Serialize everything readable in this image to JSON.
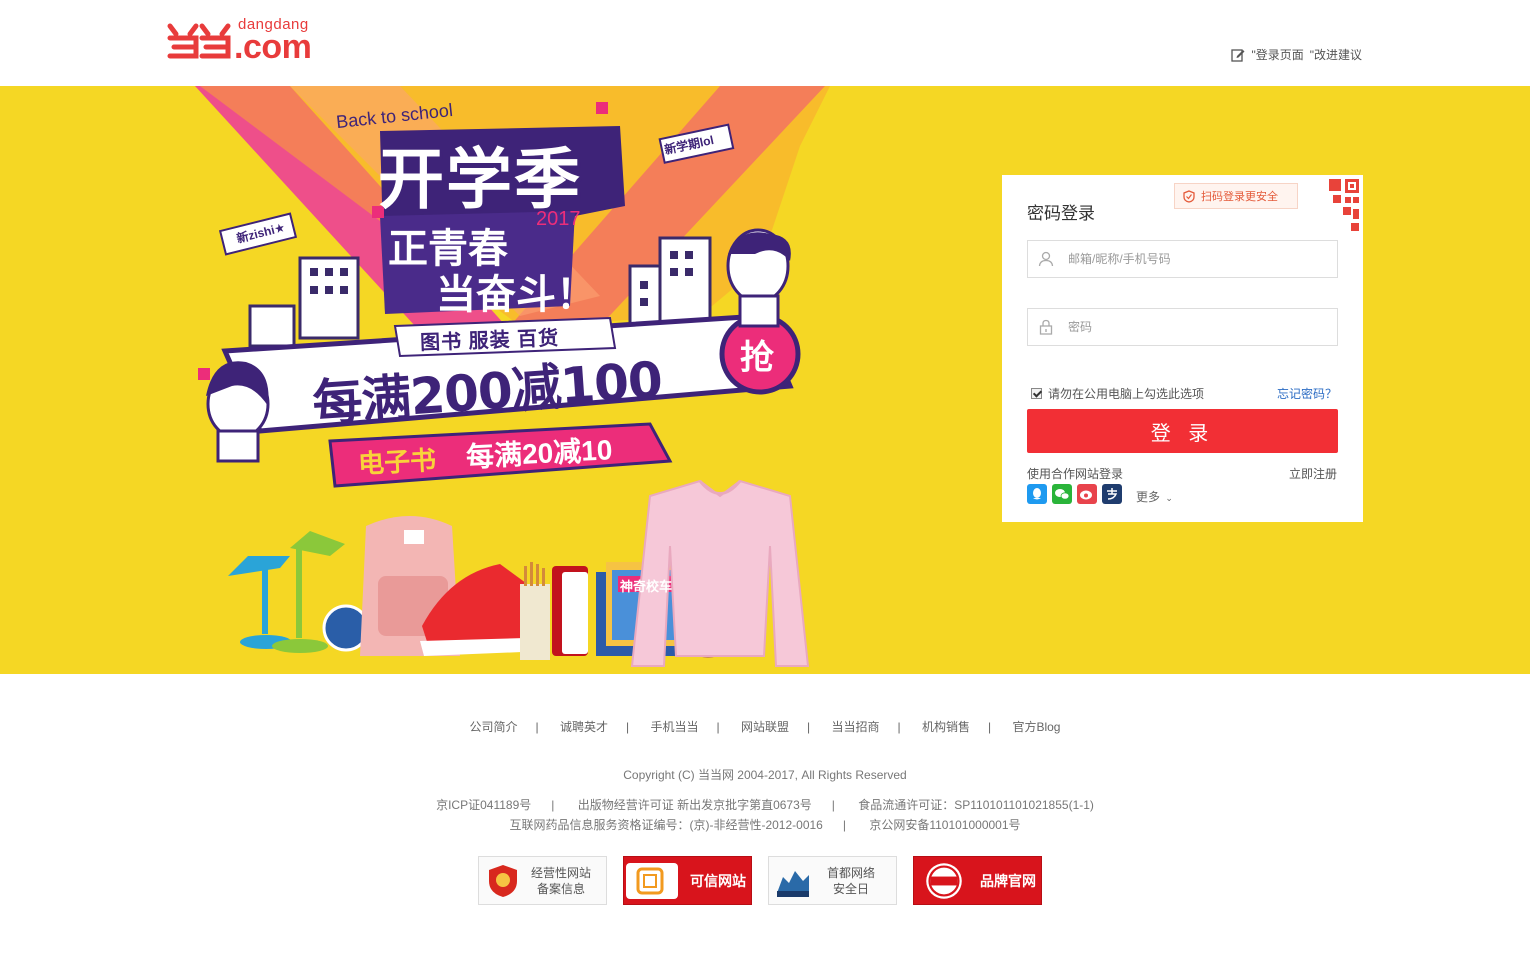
{
  "header": {
    "logo_small": "dangdang",
    "logo_big": ".com",
    "feedback_prefix": "\"登录页面",
    "feedback_suffix": "\"改进建议"
  },
  "banner": {
    "back_to_school": "Back to school",
    "headline": "开学季",
    "sub1": "正青春",
    "year": "2017",
    "sub2": "当奋斗！",
    "tag_new_term": "新学期lol",
    "tag_xin": "新zishi★",
    "cats": "图书 服装 百货",
    "offer": "每满200减100",
    "grab": "抢",
    "ebook_label": "电子书",
    "ebook_offer": "每满20减10",
    "book_title": "神奇校车",
    "bg_color": "#f5d724"
  },
  "login": {
    "title": "密码登录",
    "qr_tip": "扫码登录更安全",
    "username_placeholder": "邮箱/昵称/手机号码",
    "password_placeholder": "密码",
    "remember_label": "请勿在公用电脑上勾选此选项",
    "forgot_label": "忘记密码？",
    "login_button": "登 录",
    "partner_label": "使用合作网站登录",
    "register_label": "立即注册",
    "more_label": "更多",
    "button_color": "#f22f35"
  },
  "footer": {
    "links": [
      "公司简介",
      "诚聘英才",
      "手机当当",
      "网站联盟",
      "当当招商",
      "机构销售",
      "官方Blog"
    ],
    "copyright": "Copyright (C) 当当网 2004-2017, All Rights Reserved",
    "icp": "京ICP证041189号",
    "publication": "出版物经营许可证 新出发京批字第直0673号",
    "food": "食品流通许可证：SP110101101021855(1-1)",
    "drug": "互联网药品信息服务资格证编号：(京)-非经营性-2012-0016",
    "police": "京公网安备110101000001号",
    "badges": [
      {
        "line1": "经营性网站",
        "line2": "备案信息"
      },
      {
        "line1": "可信网站",
        "line2": ""
      },
      {
        "line1": "首都网络",
        "line2": "安全日"
      },
      {
        "line1": "品牌官网",
        "line2": ""
      }
    ]
  }
}
